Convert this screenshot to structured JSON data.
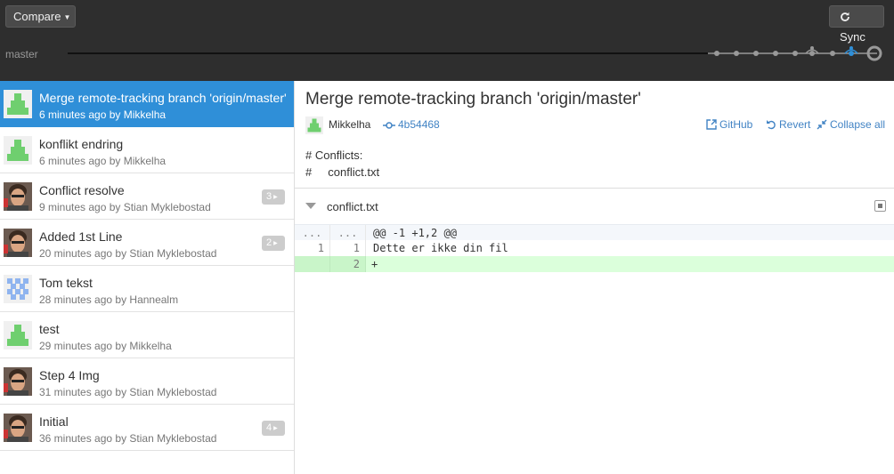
{
  "toolbar": {
    "compare_label": "Compare",
    "sync_label": "Sync",
    "branch_label": "master"
  },
  "commits": [
    {
      "title": "Merge remote-tracking branch 'origin/master'",
      "meta": "6 minutes ago by Mikkelha",
      "avatar": "identicon-green",
      "badge": ""
    },
    {
      "title": "konflikt endring",
      "meta": "6 minutes ago by Mikkelha",
      "avatar": "identicon-green",
      "badge": ""
    },
    {
      "title": "Conflict resolve",
      "meta": "9 minutes ago by Stian Myklebostad",
      "avatar": "photo-avatar",
      "badge": "3"
    },
    {
      "title": "Added 1st Line",
      "meta": "20 minutes ago by Stian Myklebostad",
      "avatar": "photo-avatar",
      "badge": "2"
    },
    {
      "title": "Tom tekst",
      "meta": "28 minutes ago by Hannealm",
      "avatar": "identicon-blue",
      "badge": ""
    },
    {
      "title": "test",
      "meta": "29 minutes ago by Mikkelha",
      "avatar": "identicon-green",
      "badge": ""
    },
    {
      "title": "Step 4 Img",
      "meta": "31 minutes ago by Stian Myklebostad",
      "avatar": "photo-avatar",
      "badge": ""
    },
    {
      "title": "Initial",
      "meta": "36 minutes ago by Stian Myklebostad",
      "avatar": "photo-avatar",
      "badge": "4"
    }
  ],
  "detail": {
    "title": "Merge remote-tracking branch 'origin/master'",
    "author": "Mikkelha",
    "sha": "4b54468",
    "actions": {
      "github": "GitHub",
      "revert": "Revert",
      "collapse": "Collapse all"
    },
    "body_line1": "# Conflicts:",
    "body_line2": "#\tconflict.txt",
    "file": {
      "name": "conflict.txt",
      "hunk": {
        "old": "...",
        "new": "...",
        "text": "@@ -1 +1,2 @@"
      },
      "lines": [
        {
          "old": "1",
          "new": "1",
          "text": "Dette er ikke din fil",
          "type": "ctx"
        },
        {
          "old": "",
          "new": "2",
          "text": "+",
          "type": "add"
        }
      ]
    }
  },
  "colors": {
    "selected": "#2f8fd8",
    "link": "#4183c4",
    "identicon_green": "#6fcf6f",
    "identicon_blue": "#8fb4ef",
    "added_line": "#dbffdb"
  }
}
